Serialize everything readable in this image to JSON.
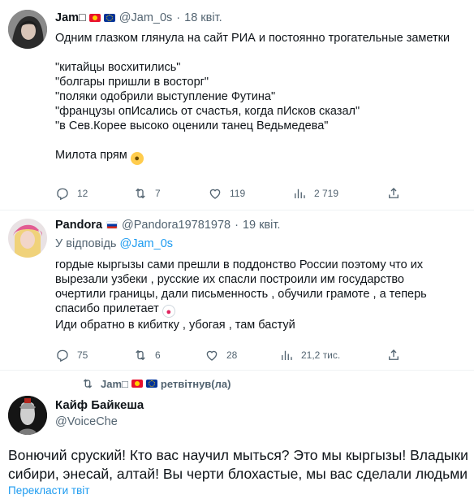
{
  "tweets": [
    {
      "name": "Jam□",
      "flags": [
        "kg",
        "eu"
      ],
      "handle": "@Jam_0s",
      "dot": "·",
      "date": "18 квіт.",
      "lines": [
        "Одним глазком глянула на сайт РИА и постоянно трогательные заметки",
        "",
        "\"китайцы восхитились\"",
        "\"болгары пришли в восторг\"",
        "\"поляки одобрили выступление Футина\"",
        "\"французы опИсались от счастья, когда пИсков сказал\"",
        "\"в Сев.Корее высоко оценили танец Ведьмедева\"",
        ""
      ],
      "last_line": "Милота прям",
      "last_emoji": "hand-over-mouth-face",
      "replies": "12",
      "retweets": "7",
      "likes": "119",
      "views": "2 719"
    },
    {
      "name": "Pandora",
      "flags": [
        "ru"
      ],
      "handle": "@Pandora19781978",
      "dot": "·",
      "date": "19 квіт.",
      "reply_prefix": "У відповідь",
      "reply_handle": "@Jam_0s",
      "lines": [
        "гордые кыргызы сами прешли в поддонство России поэтому что их",
        "вырезали узбеки , русские их спасли построили им государство",
        "очертили границы, дали письменность , обучили грамоте , а теперь"
      ],
      "line4": "спасибо прилетает",
      "line4_emoji": "clown-face",
      "line5": "Иди обратно в кибитку , убогая , там бастуй",
      "replies": "75",
      "retweets": "6",
      "likes": "28",
      "views": "21,2 тис."
    }
  ],
  "retweet_bar": {
    "name": "Jam□",
    "suffix": "ретвітнув(ла)"
  },
  "main": {
    "name": "Кайф Байкеша",
    "handle": "@VoiceChe",
    "lines": [
      "Вонючий сруский! Кто вас научил мыться? Это мы кыргызы! Владыки",
      "сибири, энесай, алтай! Вы черти блохастые, мы вас сделали людьми"
    ],
    "translate_label": "Перекласти твіт"
  },
  "colors": {
    "text": "#0f1419",
    "secondary": "#536471",
    "link": "#1d9bf0",
    "divider": "#eff3f4"
  }
}
